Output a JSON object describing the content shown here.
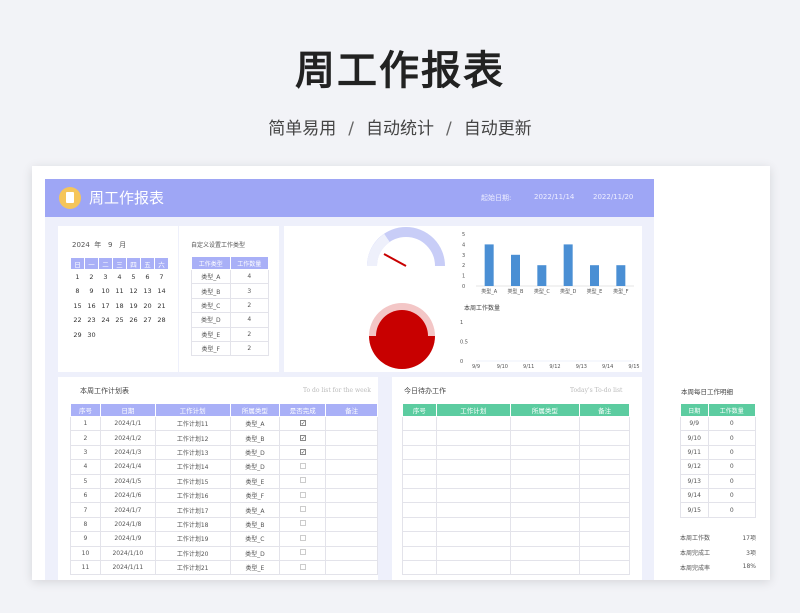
{
  "hero": {
    "title": "周工作报表",
    "tag1": "简单易用",
    "tag2": "自动统计",
    "tag3": "自动更新",
    "sep": "/"
  },
  "banner": {
    "title": "周工作报表",
    "start_label": "起始日期:",
    "start_date": "2022/11/14",
    "end_date": "2022/11/20"
  },
  "calendar": {
    "year": "2024",
    "year_unit": "年",
    "month": "9",
    "month_unit": "月",
    "weekdays": [
      "日",
      "一",
      "二",
      "三",
      "四",
      "五",
      "六"
    ],
    "weeks": [
      [
        "1",
        "2",
        "3",
        "4",
        "5",
        "6",
        "7"
      ],
      [
        "8",
        "9",
        "10",
        "11",
        "12",
        "13",
        "14"
      ],
      [
        "15",
        "16",
        "17",
        "18",
        "19",
        "20",
        "21"
      ],
      [
        "22",
        "23",
        "24",
        "25",
        "26",
        "27",
        "28"
      ],
      [
        "29",
        "30",
        "",
        "",
        "",
        "",
        ""
      ]
    ]
  },
  "types": {
    "title": "自定义设置工作类型",
    "headers": [
      "工作类型",
      "工作数量"
    ],
    "rows": [
      [
        "类型_A",
        "4"
      ],
      [
        "类型_B",
        "3"
      ],
      [
        "类型_C",
        "2"
      ],
      [
        "类型_D",
        "4"
      ],
      [
        "类型_E",
        "2"
      ],
      [
        "类型_F",
        "2"
      ]
    ]
  },
  "chart_data": [
    {
      "type": "bar",
      "title": "",
      "categories": [
        "类型_A",
        "类型_B",
        "类型_C",
        "类型_D",
        "类型_E",
        "类型_F"
      ],
      "values": [
        4,
        3,
        2,
        4,
        2,
        2
      ],
      "ylim": [
        0,
        5
      ],
      "yticks": [
        "0",
        "1",
        "2",
        "3",
        "4",
        "5"
      ]
    },
    {
      "type": "line",
      "title": "本周工作数量",
      "categories": [
        "9/9",
        "9/10",
        "9/11",
        "9/12",
        "9/13",
        "9/14",
        "9/15"
      ],
      "values": [
        0,
        0,
        0,
        0,
        0,
        0,
        0
      ],
      "ylim": [
        0,
        1
      ],
      "yticks": [
        "0",
        "0.5",
        "1"
      ]
    }
  ],
  "plan": {
    "title": "本周工作计划表",
    "note": "To do list for the week",
    "headers": [
      "序号",
      "日期",
      "工作计划",
      "所属类型",
      "是否完成",
      "备注"
    ],
    "rows": [
      [
        "1",
        "2024/1/1",
        "工作计划11",
        "类型_A",
        "true",
        ""
      ],
      [
        "2",
        "2024/1/2",
        "工作计划12",
        "类型_B",
        "true",
        ""
      ],
      [
        "3",
        "2024/1/3",
        "工作计划13",
        "类型_D",
        "true",
        ""
      ],
      [
        "4",
        "2024/1/4",
        "工作计划14",
        "类型_D",
        "false",
        ""
      ],
      [
        "5",
        "2024/1/5",
        "工作计划15",
        "类型_E",
        "false",
        ""
      ],
      [
        "6",
        "2024/1/6",
        "工作计划16",
        "类型_F",
        "false",
        ""
      ],
      [
        "7",
        "2024/1/7",
        "工作计划17",
        "类型_A",
        "false",
        ""
      ],
      [
        "8",
        "2024/1/8",
        "工作计划18",
        "类型_B",
        "false",
        ""
      ],
      [
        "9",
        "2024/1/9",
        "工作计划19",
        "类型_C",
        "false",
        ""
      ],
      [
        "10",
        "2024/1/10",
        "工作计划20",
        "类型_D",
        "false",
        ""
      ],
      [
        "11",
        "2024/1/11",
        "工作计划21",
        "类型_E",
        "false",
        ""
      ]
    ]
  },
  "todo": {
    "title": "今日待办工作",
    "note": "Today's To-do list",
    "headers": [
      "序号",
      "工作计划",
      "所属类型",
      "备注"
    ]
  },
  "daily": {
    "title": "本周每日工作明细",
    "headers": [
      "日期",
      "工作数量"
    ],
    "rows": [
      [
        "9/9",
        "0"
      ],
      [
        "9/10",
        "0"
      ],
      [
        "9/11",
        "0"
      ],
      [
        "9/12",
        "0"
      ],
      [
        "9/13",
        "0"
      ],
      [
        "9/14",
        "0"
      ],
      [
        "9/15",
        "0"
      ]
    ],
    "summary": [
      [
        "本周工作数",
        "17项"
      ],
      [
        "本周完成工",
        "3项"
      ],
      [
        "本周完成率",
        "18%"
      ]
    ]
  },
  "colors": {
    "accent": "#9ea6f5",
    "header_purple": "#a9b0f7",
    "header_green": "#5ccca0",
    "bar": "#4a8fd4",
    "gauge_red": "#c80000"
  }
}
